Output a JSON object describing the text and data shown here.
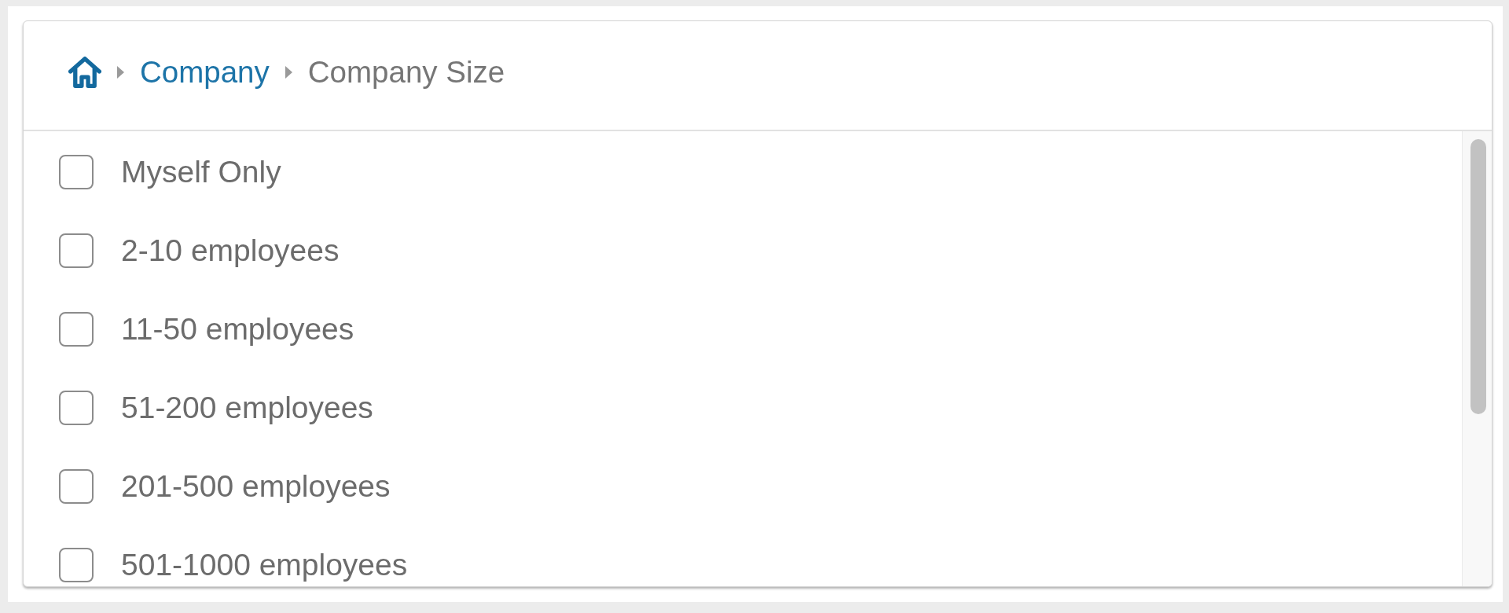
{
  "breadcrumb": {
    "items": [
      {
        "kind": "home"
      },
      {
        "kind": "link",
        "label": "Company"
      },
      {
        "kind": "current",
        "label": "Company Size"
      }
    ]
  },
  "options": [
    {
      "label": "Myself Only",
      "checked": false
    },
    {
      "label": "2-10 employees",
      "checked": false
    },
    {
      "label": "11-50 employees",
      "checked": false
    },
    {
      "label": "51-200 employees",
      "checked": false
    },
    {
      "label": "201-500 employees",
      "checked": false
    },
    {
      "label": "501-1000 employees",
      "checked": false
    }
  ]
}
